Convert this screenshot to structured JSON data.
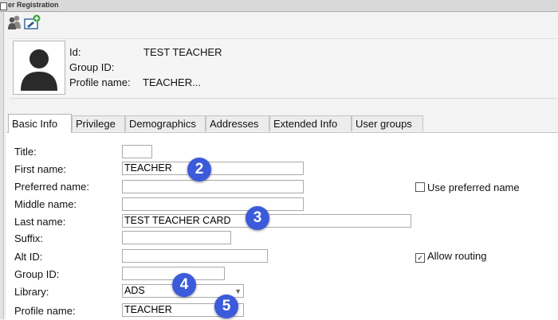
{
  "window": {
    "title": "er Registration"
  },
  "toolbar": {
    "icons": [
      "users-icon",
      "add-user-icon"
    ]
  },
  "header": {
    "id_label": "Id:",
    "id_value": "TEST TEACHER",
    "group_label": "Group ID:",
    "group_value": "",
    "profile_label": "Profile name:",
    "profile_value": "TEACHER..."
  },
  "tabs": [
    "Basic Info",
    "Privilege",
    "Demographics",
    "Addresses",
    "Extended Info",
    "User groups"
  ],
  "form": {
    "title_label": "Title:",
    "title_value": "",
    "first_name_label": "First name:",
    "first_name_value": "TEACHER",
    "preferred_name_label": "Preferred name:",
    "preferred_name_value": "",
    "middle_name_label": "Middle name:",
    "middle_name_value": "",
    "last_name_label": "Last name:",
    "last_name_value": "TEST TEACHER CARD",
    "suffix_label": "Suffix:",
    "suffix_value": "",
    "alt_id_label": "Alt ID:",
    "alt_id_value": "",
    "group_id_label": "Group ID:",
    "group_id_value": "",
    "library_label": "Library:",
    "library_value": "ADS",
    "profile_name_label": "Profile name:",
    "profile_name_value": "TEACHER",
    "use_preferred_label": "Use preferred name",
    "use_preferred_checked": false,
    "allow_routing_label": "Allow routing",
    "allow_routing_checked": true
  },
  "badges": [
    "2",
    "3",
    "4",
    "5"
  ],
  "colors": {
    "badge": "#3b5bdb",
    "tab_active": "#ffffff",
    "window_bg": "#f3f3f3"
  }
}
